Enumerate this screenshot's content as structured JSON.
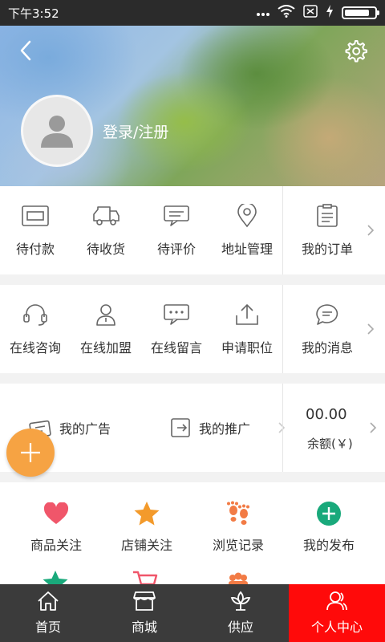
{
  "status_bar": {
    "time": "下午3:52",
    "battery_level": 0.85
  },
  "header": {
    "login_label": "登录/注册"
  },
  "orders": {
    "items": [
      {
        "label": "待付款",
        "icon": "wallet-icon"
      },
      {
        "label": "待收货",
        "icon": "truck-icon"
      },
      {
        "label": "待评价",
        "icon": "comment-icon"
      },
      {
        "label": "地址管理",
        "icon": "location-pin-icon"
      }
    ],
    "side": {
      "label": "我的订单",
      "icon": "order-list-icon"
    }
  },
  "services": {
    "items": [
      {
        "label": "在线咨询",
        "icon": "headset-icon"
      },
      {
        "label": "在线加盟",
        "icon": "person-icon"
      },
      {
        "label": "在线留言",
        "icon": "chat-bubble-icon"
      },
      {
        "label": "申请职位",
        "icon": "upload-icon"
      }
    ],
    "side": {
      "label": "我的消息",
      "icon": "message-icon"
    }
  },
  "promotion": {
    "ads_label": "我的广告",
    "referral_label": "我的推广",
    "balance_amount": "00.00",
    "balance_label": "余额(￥)"
  },
  "favorites": [
    {
      "label": "商品关注",
      "icon": "heart-icon",
      "color": "#f0566a"
    },
    {
      "label": "店铺关注",
      "icon": "star-icon",
      "color": "#f39a2b"
    },
    {
      "label": "浏览记录",
      "icon": "footprint-icon",
      "color": "#f27b45"
    },
    {
      "label": "我的发布",
      "icon": "plus-circle-icon",
      "color": "#19a97b"
    }
  ],
  "tabbar": [
    {
      "label": "首页",
      "icon": "home-icon"
    },
    {
      "label": "商城",
      "icon": "store-icon"
    },
    {
      "label": "供应",
      "icon": "leaf-icon"
    },
    {
      "label": "个人中心",
      "icon": "user-icon",
      "active": true
    }
  ],
  "colors": {
    "accent": "#ff0a0a",
    "fab": "#f6a343",
    "tabbar": "#3b3b3b"
  }
}
